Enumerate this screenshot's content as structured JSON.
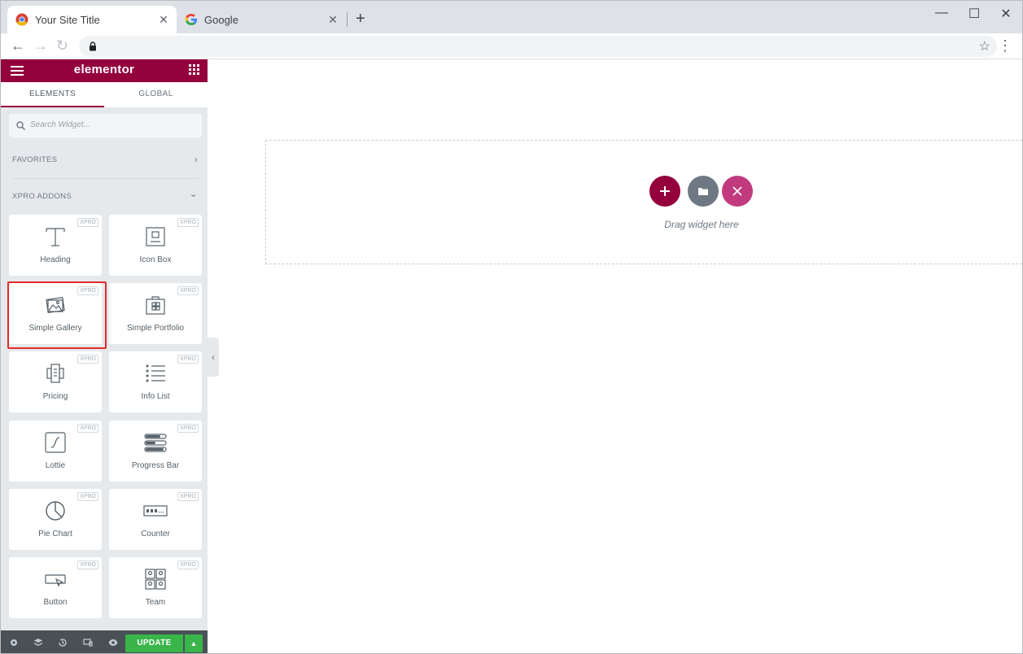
{
  "browser": {
    "tabs": [
      {
        "title": "Your Site Title",
        "active": true
      },
      {
        "title": "Google",
        "active": false
      }
    ],
    "new_tab_symbol": "+",
    "tab_close_symbol": "✕",
    "nav": {
      "back": "←",
      "forward": "→",
      "reload": "↻"
    },
    "window_controls": {
      "minimize": "—",
      "maximize": "☐",
      "close": "✕"
    },
    "bookmark_symbol": "☆",
    "menu_symbol": "⋮",
    "icons": [
      "chrome-icon",
      "google-icon",
      "lock-icon",
      "star-icon"
    ]
  },
  "panel": {
    "brand": "elementor",
    "accent_color": "#93003c",
    "tabs": [
      "ELEMENTS",
      "GLOBAL"
    ],
    "search_placeholder": "Search Widget...",
    "categories": [
      {
        "label": "FAVORITES",
        "chevron": "›"
      },
      {
        "label": "XPRO ADDONS",
        "chevron": "⌄"
      }
    ],
    "widgets": [
      {
        "label": "Heading",
        "icon": "heading-icon",
        "badge": "XPRO"
      },
      {
        "label": "Icon Box",
        "icon": "icon-box-icon",
        "badge": "XPRO"
      },
      {
        "label": "Simple Gallery",
        "icon": "gallery-icon",
        "badge": "XPRO",
        "highlighted": true
      },
      {
        "label": "Simple Portfolio",
        "icon": "portfolio-icon",
        "badge": "XPRO"
      },
      {
        "label": "Pricing",
        "icon": "pricing-icon",
        "badge": "XPRO"
      },
      {
        "label": "Info List",
        "icon": "info-list-icon",
        "badge": "XPRO"
      },
      {
        "label": "Lottie",
        "icon": "lottie-icon",
        "badge": "XPRO"
      },
      {
        "label": "Progress Bar",
        "icon": "progress-bar-icon",
        "badge": "XPRO"
      },
      {
        "label": "Pie Chart",
        "icon": "pie-chart-icon",
        "badge": "XPRO"
      },
      {
        "label": "Counter",
        "icon": "counter-icon",
        "badge": "XPRO"
      },
      {
        "label": "Button",
        "icon": "button-icon",
        "badge": "XPRO"
      },
      {
        "label": "Team",
        "icon": "team-icon",
        "badge": "XPRO"
      }
    ],
    "footer": {
      "update_label": "UPDATE",
      "update_color": "#39b54a",
      "icons": [
        "settings-icon",
        "navigator-icon",
        "history-icon",
        "responsive-icon",
        "preview-icon"
      ],
      "arrow_symbol": "▲"
    },
    "collapse_symbol": "‹"
  },
  "canvas": {
    "drop_text": "Drag widget here",
    "buttons": [
      "add-section-button",
      "add-template-button",
      "xpro-templates-button"
    ]
  }
}
